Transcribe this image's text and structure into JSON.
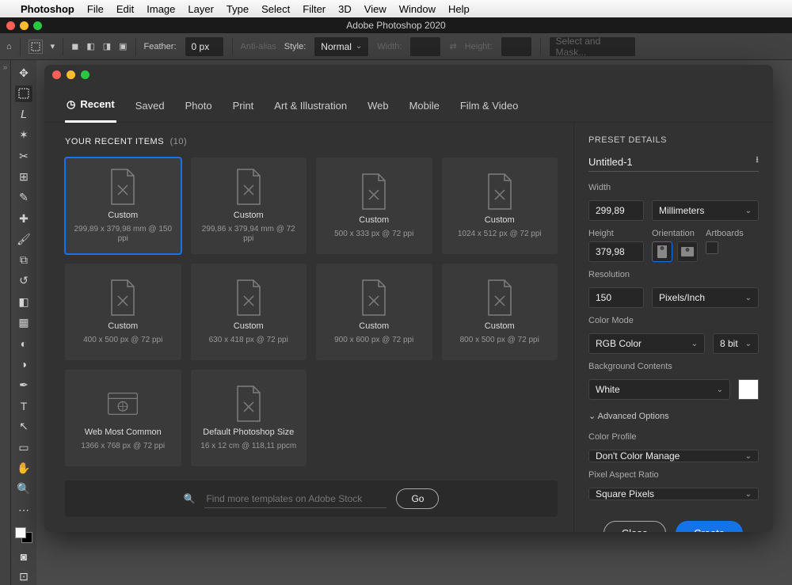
{
  "mac_menu": [
    "Photoshop",
    "File",
    "Edit",
    "Image",
    "Layer",
    "Type",
    "Select",
    "Filter",
    "3D",
    "View",
    "Window",
    "Help"
  ],
  "app_title": "Adobe Photoshop 2020",
  "options_bar": {
    "feather_label": "Feather:",
    "feather_value": "0 px",
    "antialias_label": "Anti-alias",
    "style_label": "Style:",
    "style_value": "Normal",
    "width_label": "Width:",
    "height_label": "Height:",
    "mask_btn": "Select and Mask..."
  },
  "dialog": {
    "tabs": [
      "Recent",
      "Saved",
      "Photo",
      "Print",
      "Art & Illustration",
      "Web",
      "Mobile",
      "Film & Video"
    ],
    "active_tab": "Recent",
    "section_label": "YOUR RECENT ITEMS",
    "section_count": "(10)",
    "cards": [
      {
        "title": "Custom",
        "sub": "299,89 x 379,98 mm @ 150 ppi",
        "icon": "doc",
        "selected": true
      },
      {
        "title": "Custom",
        "sub": "299,86 x 379,94 mm @ 72 ppi",
        "icon": "doc"
      },
      {
        "title": "Custom",
        "sub": "500 x 333 px @ 72 ppi",
        "icon": "doc"
      },
      {
        "title": "Custom",
        "sub": "1024 x 512 px @ 72 ppi",
        "icon": "doc"
      },
      {
        "title": "Custom",
        "sub": "400 x 500 px @ 72 ppi",
        "icon": "doc"
      },
      {
        "title": "Custom",
        "sub": "630 x 418 px @ 72 ppi",
        "icon": "doc"
      },
      {
        "title": "Custom",
        "sub": "900 x 600 px @ 72 ppi",
        "icon": "doc"
      },
      {
        "title": "Custom",
        "sub": "800 x 500 px @ 72 ppi",
        "icon": "doc"
      },
      {
        "title": "Web Most Common",
        "sub": "1366 x 768 px @ 72 ppi",
        "icon": "web"
      },
      {
        "title": "Default Photoshop Size",
        "sub": "16 x 12 cm @ 118,11 ppcm",
        "icon": "doc"
      }
    ],
    "search_placeholder": "Find more templates on Adobe Stock",
    "go_label": "Go",
    "close_label": "Close",
    "create_label": "Create"
  },
  "preset": {
    "header": "PRESET DETAILS",
    "name_value": "Untitled-1",
    "width_label": "Width",
    "width_value": "299,89",
    "width_unit": "Millimeters",
    "height_label": "Height",
    "height_value": "379,98",
    "orientation_label": "Orientation",
    "artboards_label": "Artboards",
    "resolution_label": "Resolution",
    "resolution_value": "150",
    "resolution_unit": "Pixels/Inch",
    "colormode_label": "Color Mode",
    "colormode_value": "RGB Color",
    "bitdepth_value": "8 bit",
    "bg_label": "Background Contents",
    "bg_value": "White",
    "advanced_label": "Advanced Options",
    "profile_label": "Color Profile",
    "profile_value": "Don't Color Manage",
    "aspect_label": "Pixel Aspect Ratio",
    "aspect_value": "Square Pixels"
  }
}
